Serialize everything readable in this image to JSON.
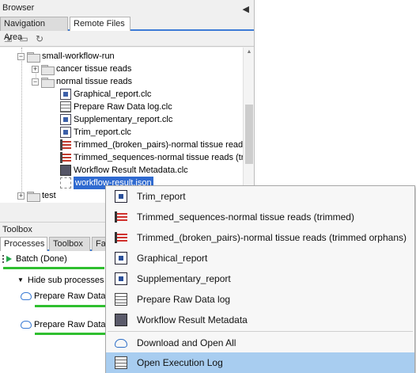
{
  "browser": {
    "title": "Browser",
    "tabs": [
      "Navigation Area",
      "Remote Files"
    ]
  },
  "tree": {
    "workflow_run": "small-workflow-run",
    "cancer": "cancer tissue reads",
    "normal": "normal tissue reads",
    "files": [
      "Graphical_report.clc",
      "Prepare Raw Data log.clc",
      "Supplementary_report.clc",
      "Trim_report.clc",
      "Trimmed_(broken_pairs)-normal tissue reads",
      "Trimmed_sequences-normal tissue reads (tri",
      "Workflow Result Metadata.clc"
    ],
    "selected": "workflow-result.json",
    "test": "test"
  },
  "toolbox": {
    "title": "Toolbox",
    "tabs": [
      "Processes",
      "Toolbox",
      "Fa"
    ],
    "batch": "Batch (Done)",
    "hide_sub": "Hide sub processes",
    "proc1": "Prepare Raw Data",
    "proc2": "Prepare Raw Data"
  },
  "menu": {
    "items": [
      "Trim_report",
      "Trimmed_sequences-normal tissue reads (trimmed)",
      "Trimmed_(broken_pairs)-normal tissue reads (trimmed orphans)",
      "Graphical_report",
      "Supplementary_report",
      "Prepare Raw Data log",
      "Workflow Result Metadata",
      "Download and Open All",
      "Open Execution Log"
    ]
  },
  "colors": {
    "selection": "#2f6ad0",
    "menu_highlight": "#a8cdf0",
    "progress": "#2fbf2f",
    "tab_accent": "#3d7bd6"
  }
}
